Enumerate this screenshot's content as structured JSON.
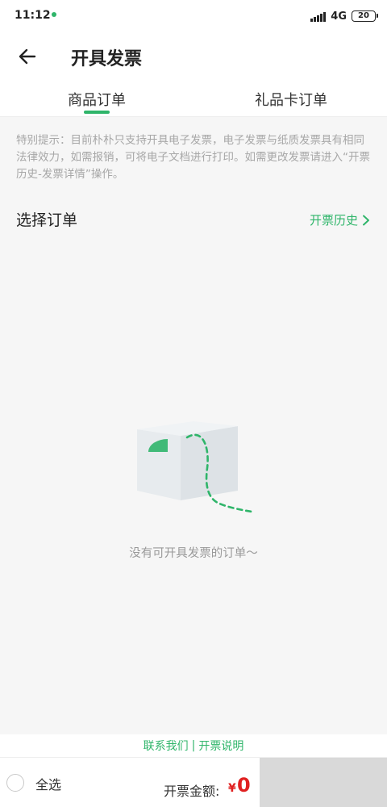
{
  "status": {
    "time": "11:12",
    "network": "4G",
    "battery": "20"
  },
  "nav": {
    "title": "开具发票"
  },
  "tabs": [
    {
      "label": "商品订单"
    },
    {
      "label": "礼品卡订单"
    }
  ],
  "notice": "特别提示：目前朴朴只支持开具电子发票，电子发票与纸质发票具有相同法律效力，如需报销，可将电子文档进行打印。如需更改发票请进入“开票历史-发票详情”操作。",
  "section": {
    "title": "选择订单",
    "history_link": "开票历史"
  },
  "empty": {
    "text": "没有可开具发票的订单～"
  },
  "help": {
    "contact": "联系我们",
    "separator": "|",
    "explain": "开票说明"
  },
  "bottom": {
    "select_all": "全选",
    "amount_label": "开票金额:",
    "currency": "¥",
    "amount": "0"
  },
  "colors": {
    "accent": "#2fb56a",
    "price": "#e02020"
  }
}
